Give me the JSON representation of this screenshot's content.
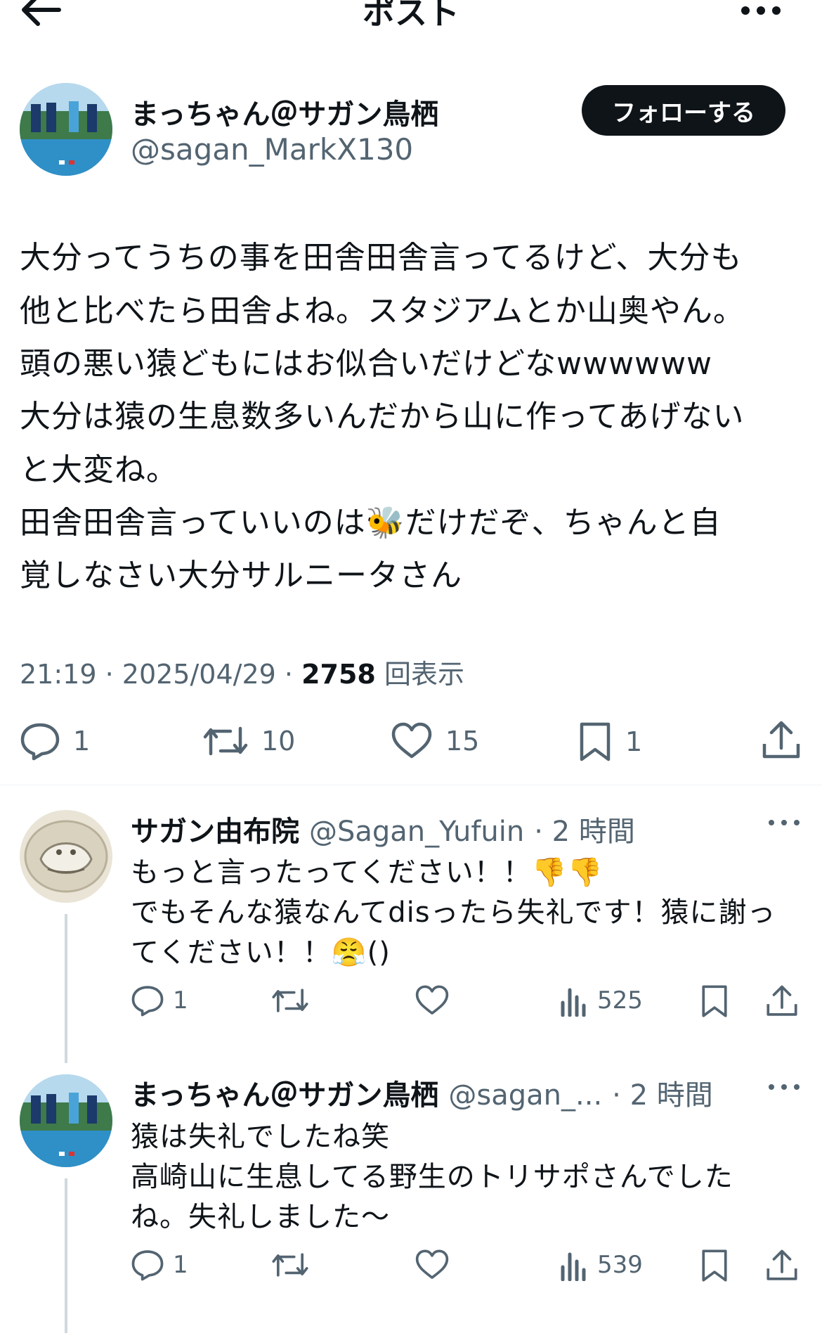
{
  "header": {
    "title": "ポスト"
  },
  "post": {
    "author_name": "まっちゃん＠サガン鳥栖",
    "author_handle": "@sagan_MarkX130",
    "follow_label": "フォローする",
    "lines": [
      "大分ってうちの事を田舎田舎言ってるけど、大分も",
      "他と比べたら田舎よね。スタジアムとか山奥やん。",
      "頭の悪い猿どもにはお似合いだけどなwwwwww",
      "大分は猿の生息数多いんだから山に作ってあげない",
      "と大変ね。",
      "田舎田舎言っていいのは🐝だけだぞ、ちゃんと自",
      "覚しなさい大分サルニータさん"
    ],
    "time": "21:19",
    "date": "2025/04/29",
    "views": "2758",
    "views_label": "回表示",
    "replies": "1",
    "reposts": "10",
    "likes": "15",
    "bookmarks": "1"
  },
  "replies": [
    {
      "author_name": "サガン由布院",
      "author_handle": "@Sagan_Yufuin",
      "time": "· 2 時間",
      "lines": [
        "もっと言ったってください！！👎👎",
        "でもそんな猿なんてdisったら失礼です！猿に謝っ",
        "てください！！😤()"
      ],
      "replies": "1",
      "views": "525"
    },
    {
      "author_name": "まっちゃん＠サガン鳥栖",
      "author_handle": "@sagan_...",
      "time": "· 2 時間",
      "lines": [
        "猿は失礼でしたね笑",
        "高崎山に生息してる野生のトリサポさんでした",
        "ね。失礼しました〜"
      ],
      "replies": "1",
      "views": "539"
    }
  ],
  "colors": {
    "text": "#0f1419",
    "secondary": "#536471",
    "divider": "#eff3f4",
    "thread_line": "#cfd9de",
    "avatar_sky": "#2f8fc7"
  }
}
